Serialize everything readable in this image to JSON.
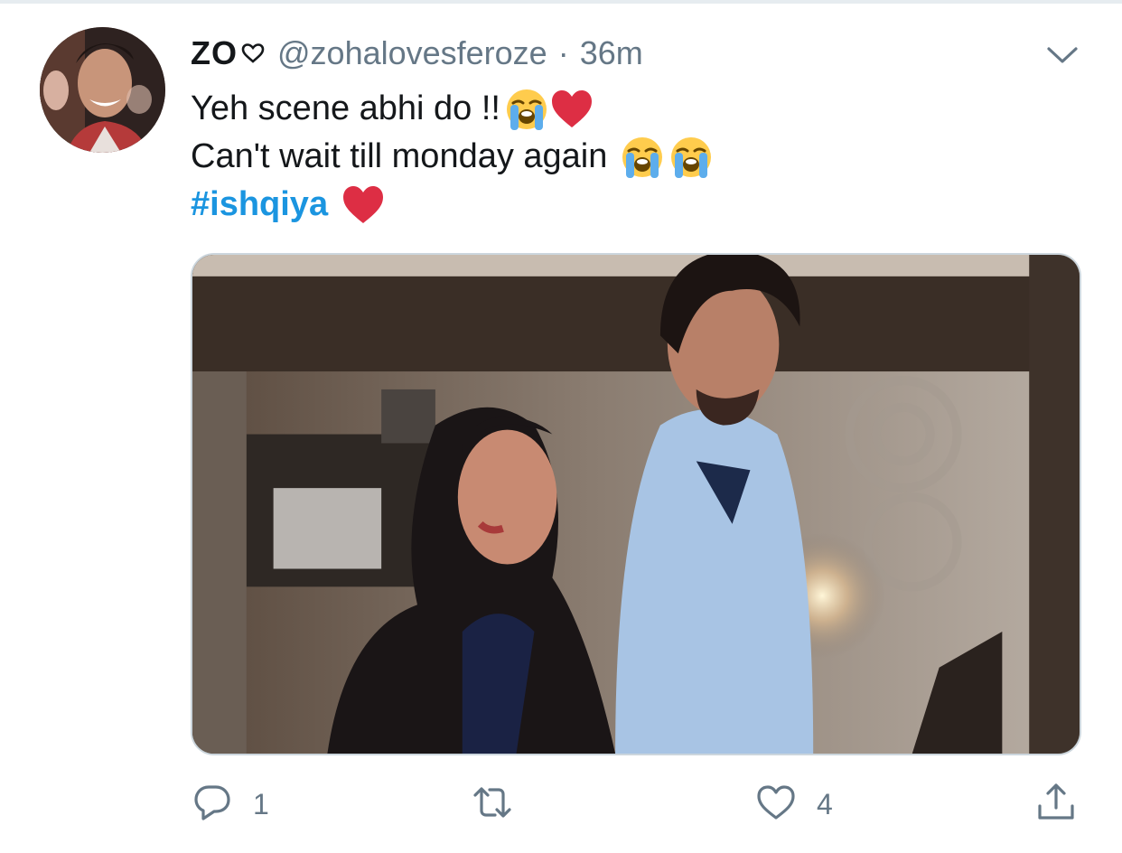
{
  "tweet": {
    "display_name": "ZO",
    "handle": "@zohalovesferoze",
    "separator": "·",
    "time": "36m",
    "text_line1": "Yeh scene abhi do !!",
    "text_line2": "Can't wait till monday again",
    "hashtag": "#ishqiya",
    "emoji": [
      "loudly-crying-face",
      "red-heart"
    ]
  },
  "actions": {
    "reply_count": "1",
    "retweet_count": "",
    "like_count": "4"
  },
  "colors": {
    "link": "#1b95e0",
    "secondary_text": "#657786",
    "primary_text": "#14171a",
    "heart_red": "#dd2e44"
  },
  "icons": [
    "heart-outline-icon",
    "chevron-down-icon",
    "reply-icon",
    "retweet-icon",
    "like-icon",
    "share-icon"
  ]
}
